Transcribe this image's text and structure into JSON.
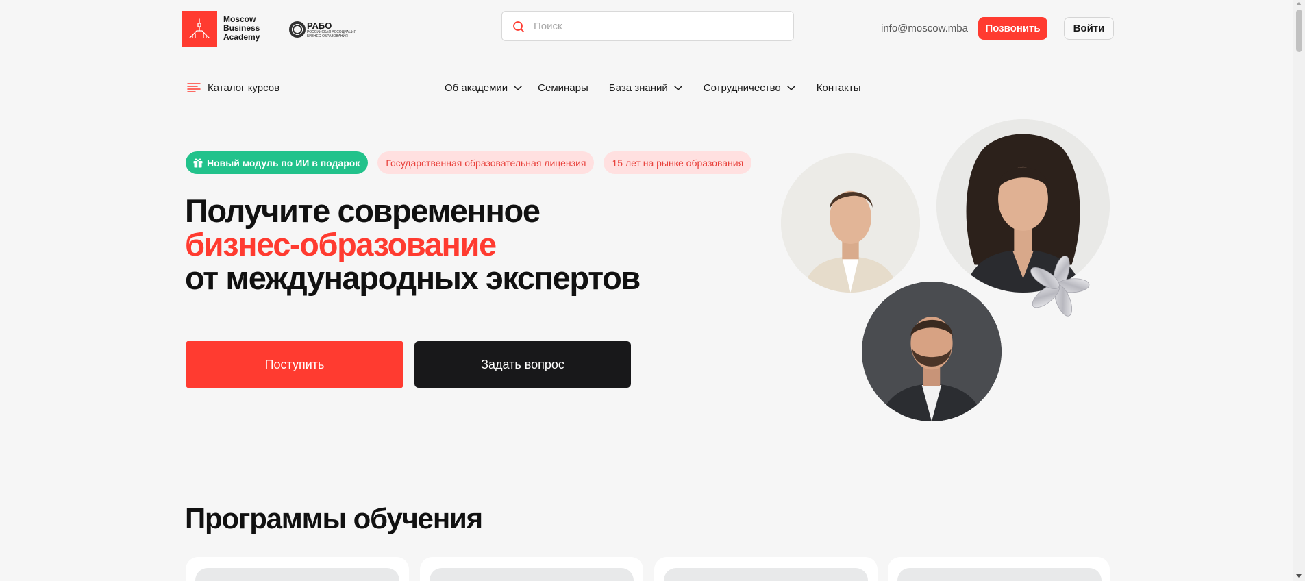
{
  "header": {
    "logo": {
      "line1": "Moscow",
      "line2": "Business",
      "line3": "Academy"
    },
    "partner_logo": {
      "title": "РАБО",
      "subtitle_line1": "РОССИЙСКАЯ АССОЦИАЦИЯ",
      "subtitle_line2": "БИЗНЕС-ОБРАЗОВАНИЯ"
    },
    "search": {
      "placeholder": "Поиск",
      "value": ""
    },
    "email": "info@moscow.mba",
    "call_label": "Позвонить",
    "login_label": "Войти"
  },
  "nav": {
    "catalog_label": "Каталог курсов",
    "items": [
      {
        "label": "Об академии",
        "has_dropdown": true
      },
      {
        "label": "Семинары",
        "has_dropdown": false
      },
      {
        "label": "База знаний",
        "has_dropdown": true
      },
      {
        "label": "Сотрудничество",
        "has_dropdown": true
      },
      {
        "label": "Контакты",
        "has_dropdown": false
      }
    ]
  },
  "hero": {
    "badges": {
      "promo": "Новый модуль по ИИ в подарок",
      "license": "Государственная образовательная лицензия",
      "years": "15 лет на рынке образования"
    },
    "title_line1": "Получите современное",
    "title_line2": "бизнес-образование",
    "title_line3": "от международных экспертов",
    "apply_label": "Поступить",
    "ask_label": "Задать вопрос"
  },
  "programs": {
    "title": "Программы обучения"
  },
  "colors": {
    "accent": "#ff3b30",
    "promo_badge": "#22c28b",
    "pink_badge_bg": "#ffe0e0",
    "dark_button": "#18181a",
    "background": "#f6f6f6"
  }
}
